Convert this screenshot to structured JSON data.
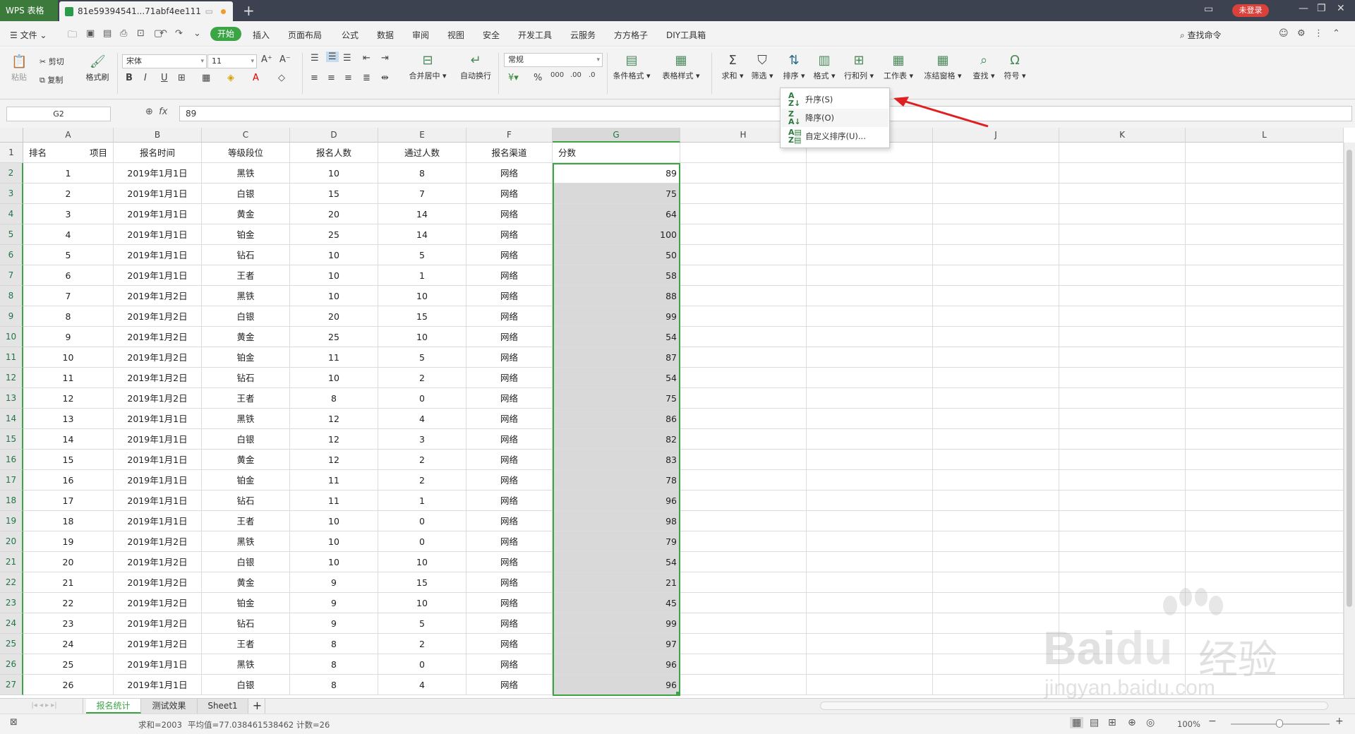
{
  "titlebar": {
    "app_tab": "WPS 表格",
    "doc_tab": "81e59394541...71abf4ee111",
    "login_badge": "未登录"
  },
  "menu": {
    "file": "文件",
    "tabs": [
      "开始",
      "插入",
      "页面布局",
      "公式",
      "数据",
      "审阅",
      "视图",
      "安全",
      "开发工具",
      "云服务",
      "方方格子",
      "DIY工具箱"
    ],
    "search": "查找命令"
  },
  "ribbon": {
    "paste": "粘贴",
    "cut": "剪切",
    "copy": "复制",
    "format_painter": "格式刷",
    "font_name": "宋体",
    "font_size": "11",
    "merge_center": "合并居中",
    "wrap_text": "自动换行",
    "number_format": "常规",
    "conditional_format": "条件格式",
    "table_style": "表格样式",
    "sum": "求和",
    "filter": "筛选",
    "sort": "排序",
    "format": "格式",
    "rows_cols": "行和列",
    "worksheet": "工作表",
    "freeze": "冻结窗格",
    "find": "查找",
    "symbol": "符号"
  },
  "formula_bar": {
    "name_box": "G2",
    "fx_label": "fx",
    "value": "89"
  },
  "sort_menu": {
    "ascending": "升序(S)",
    "descending": "降序(O)",
    "custom": "自定义排序(U)..."
  },
  "columns": [
    "A",
    "B",
    "C",
    "D",
    "E",
    "F",
    "G",
    "H",
    "I",
    "J",
    "K",
    "L"
  ],
  "header_row": {
    "a_left": "排名",
    "a_right": "项目",
    "b": "报名时间",
    "c": "等级段位",
    "d": "报名人数",
    "e": "通过人数",
    "f": "报名渠道",
    "g": "分数"
  },
  "rows": [
    [
      "1",
      "2019年1月1日",
      "黑铁",
      "10",
      "8",
      "网络",
      "89"
    ],
    [
      "2",
      "2019年1月1日",
      "白银",
      "15",
      "7",
      "网络",
      "75"
    ],
    [
      "3",
      "2019年1月1日",
      "黄金",
      "20",
      "14",
      "网络",
      "64"
    ],
    [
      "4",
      "2019年1月1日",
      "铂金",
      "25",
      "14",
      "网络",
      "100"
    ],
    [
      "5",
      "2019年1月1日",
      "钻石",
      "10",
      "5",
      "网络",
      "50"
    ],
    [
      "6",
      "2019年1月1日",
      "王者",
      "10",
      "1",
      "网络",
      "58"
    ],
    [
      "7",
      "2019年1月2日",
      "黑铁",
      "10",
      "10",
      "网络",
      "88"
    ],
    [
      "8",
      "2019年1月2日",
      "白银",
      "20",
      "15",
      "网络",
      "99"
    ],
    [
      "9",
      "2019年1月2日",
      "黄金",
      "25",
      "10",
      "网络",
      "54"
    ],
    [
      "10",
      "2019年1月2日",
      "铂金",
      "11",
      "5",
      "网络",
      "87"
    ],
    [
      "11",
      "2019年1月2日",
      "钻石",
      "10",
      "2",
      "网络",
      "54"
    ],
    [
      "12",
      "2019年1月2日",
      "王者",
      "8",
      "0",
      "网络",
      "75"
    ],
    [
      "13",
      "2019年1月1日",
      "黑铁",
      "12",
      "4",
      "网络",
      "86"
    ],
    [
      "14",
      "2019年1月1日",
      "白银",
      "12",
      "3",
      "网络",
      "82"
    ],
    [
      "15",
      "2019年1月1日",
      "黄金",
      "12",
      "2",
      "网络",
      "83"
    ],
    [
      "16",
      "2019年1月1日",
      "铂金",
      "11",
      "2",
      "网络",
      "78"
    ],
    [
      "17",
      "2019年1月1日",
      "钻石",
      "11",
      "1",
      "网络",
      "96"
    ],
    [
      "18",
      "2019年1月1日",
      "王者",
      "10",
      "0",
      "网络",
      "98"
    ],
    [
      "19",
      "2019年1月2日",
      "黑铁",
      "10",
      "0",
      "网络",
      "79"
    ],
    [
      "20",
      "2019年1月2日",
      "白银",
      "10",
      "10",
      "网络",
      "54"
    ],
    [
      "21",
      "2019年1月2日",
      "黄金",
      "9",
      "15",
      "网络",
      "21"
    ],
    [
      "22",
      "2019年1月2日",
      "铂金",
      "9",
      "10",
      "网络",
      "45"
    ],
    [
      "23",
      "2019年1月2日",
      "钻石",
      "9",
      "5",
      "网络",
      "99"
    ],
    [
      "24",
      "2019年1月2日",
      "王者",
      "8",
      "2",
      "网络",
      "97"
    ],
    [
      "25",
      "2019年1月1日",
      "黑铁",
      "8",
      "0",
      "网络",
      "96"
    ],
    [
      "26",
      "2019年1月1日",
      "白银",
      "8",
      "4",
      "网络",
      "96"
    ]
  ],
  "sheets": [
    "报名统计",
    "测试效果",
    "Sheet1"
  ],
  "status": {
    "sum": "求和=2003",
    "average": "平均值=77.038461538462",
    "count": "计数=26",
    "zoom": "100%"
  },
  "watermark": {
    "brand": "Bai",
    "brand2": "du",
    "cn": "经验",
    "url": "jingyan.baidu.com"
  },
  "colors": {
    "accent": "#3ba546",
    "titlebar": "#3c4250",
    "selection": "#d9d9d9",
    "arrow": "#e02020"
  }
}
